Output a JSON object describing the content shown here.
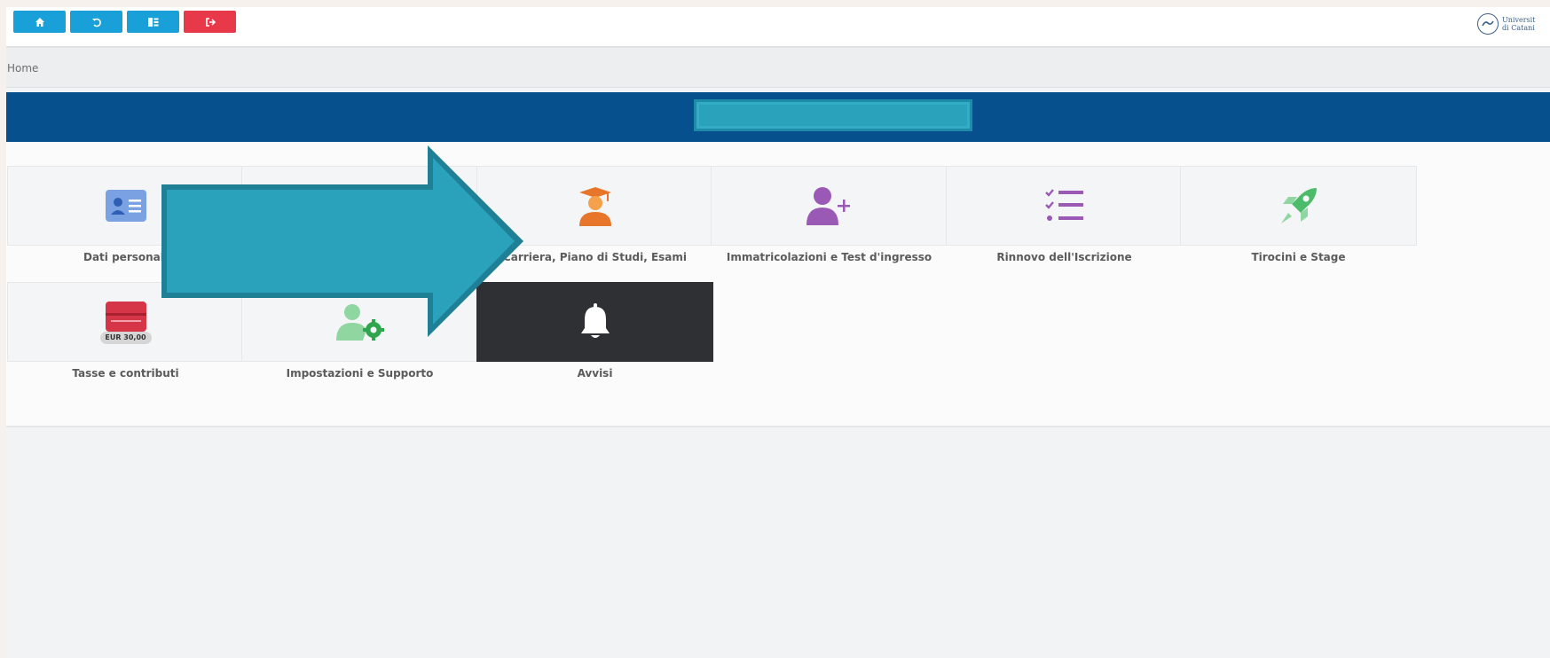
{
  "breadcrumb": {
    "home": "Home"
  },
  "toolbar": {
    "buttons": [
      {
        "icon": "home-icon",
        "color": "#1aa0d8"
      },
      {
        "icon": "undo-icon",
        "color": "#1aa0d8"
      },
      {
        "icon": "menu-toggle-icon",
        "color": "#1aa0d8"
      },
      {
        "icon": "logout-icon",
        "color": "#e8394a"
      }
    ]
  },
  "logo": {
    "line1": "Universit",
    "line2": "di Catani"
  },
  "tiles": [
    {
      "label": "Dati personali",
      "icon": "id-card-icon"
    },
    {
      "label": "Carriera, Piano di Studi, Esami",
      "icon": "graduate-icon"
    },
    {
      "label": "Immatricolazioni e Test d'ingresso",
      "icon": "add-user-icon"
    },
    {
      "label": "Rinnovo dell'Iscrizione",
      "icon": "checklist-icon"
    },
    {
      "label": "Tirocini e Stage",
      "icon": "rocket-icon"
    },
    {
      "label": "Tasse e contributi",
      "icon": "credit-card-icon",
      "badge": "EUR 30,00"
    },
    {
      "label": "Impostazioni e Supporto",
      "icon": "user-settings-icon"
    },
    {
      "label": "Avvisi",
      "icon": "bell-icon"
    }
  ],
  "colors": {
    "header_blue": "#06508e",
    "overlay_teal": "#2aa2bb",
    "graduate_orange": "#e8762a",
    "purple": "#9b59b6",
    "green": "#4cbb6a",
    "card_red": "#d63447",
    "dark_tile": "#2f3033"
  }
}
